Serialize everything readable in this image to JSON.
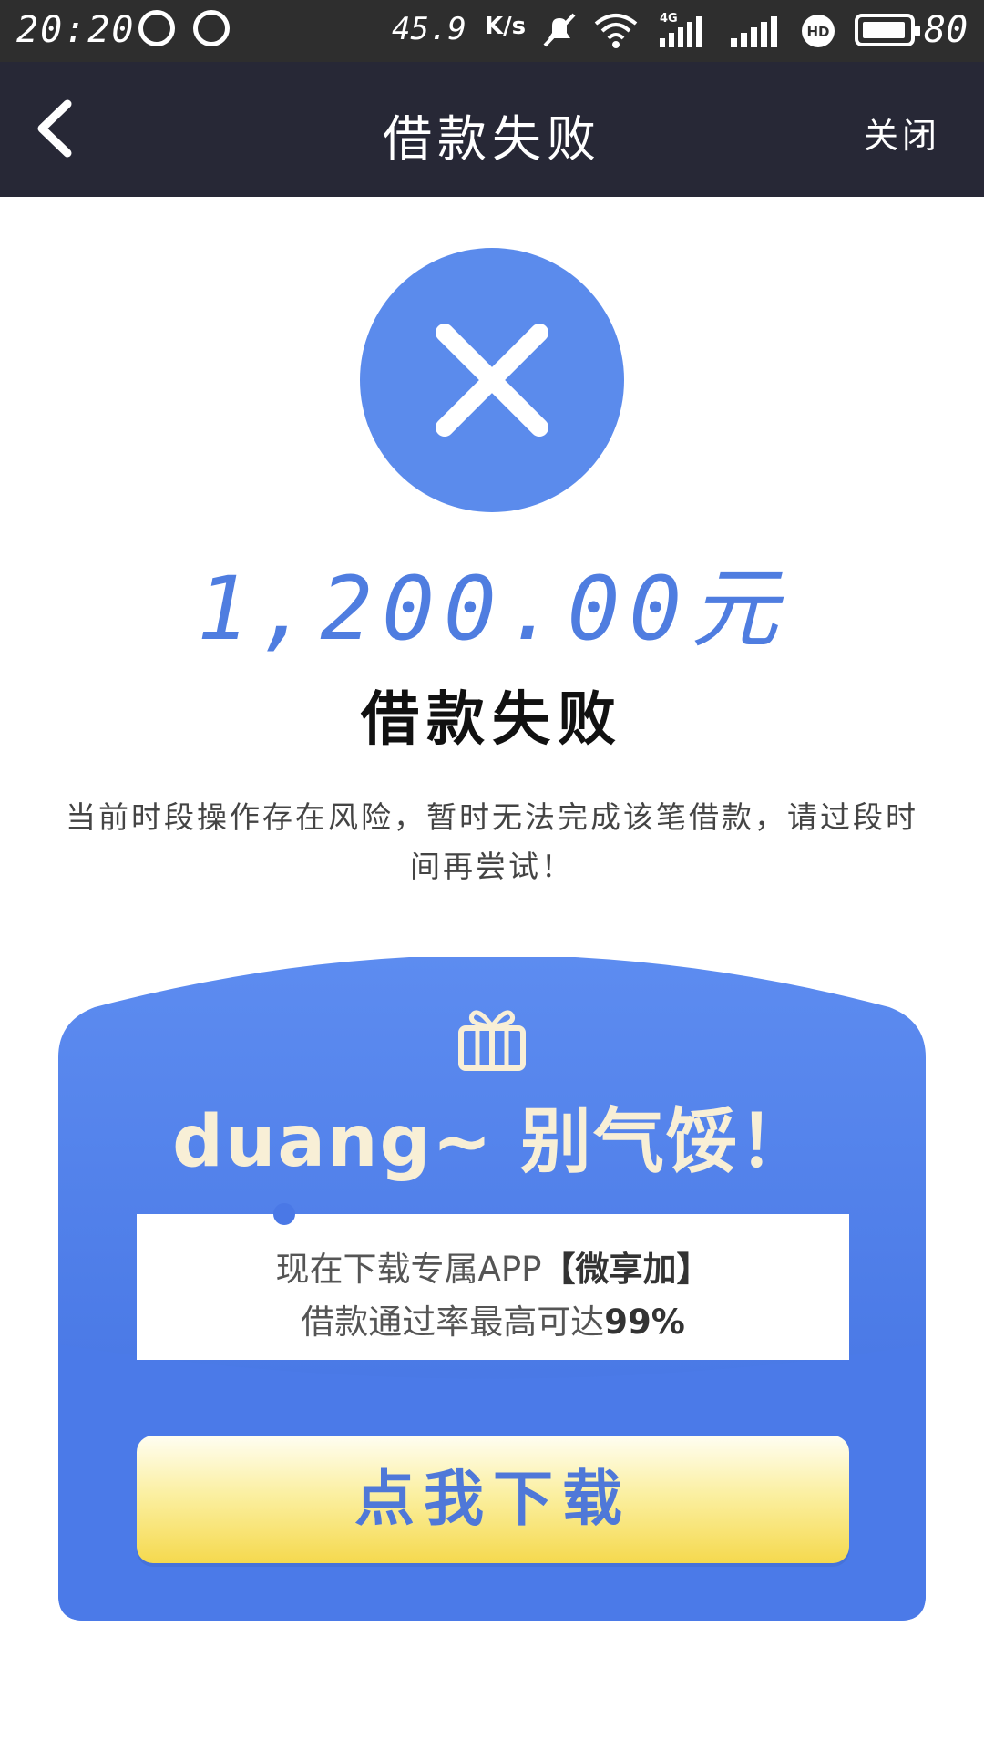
{
  "status_bar": {
    "time": "20:20",
    "network_speed": "45.9",
    "speed_unit": "K/s",
    "network_type": "4G",
    "hd_label": "HD",
    "battery_level": "80",
    "icons": [
      "smiley-notification-icon",
      "check-notification-icon",
      "mute-icon",
      "wifi-icon",
      "signal-4g-icon",
      "signal-icon",
      "hd-icon",
      "battery-icon"
    ]
  },
  "nav": {
    "back_icon": "chevron-left-icon",
    "title": "借款失败",
    "close_label": "关闭"
  },
  "result": {
    "icon": "close-icon",
    "icon_color": "#5b8bec",
    "amount": "1,200.00元",
    "title": "借款失败",
    "description": "当前时段操作存在风险，暂时无法完成该笔借款，请过段时间再尝试！"
  },
  "promo": {
    "icon": "gift-icon",
    "headline": "duang~ 别气馁！",
    "line1_prefix": "现在下载专属APP",
    "line1_app": "【微享加】",
    "line2_prefix": "借款通过率最高可达",
    "line2_rate": "99%",
    "button_label": "点我下载",
    "colors": {
      "card": "#4a78e6",
      "button": "#f5d94e",
      "headline": "#f8efd6"
    }
  }
}
